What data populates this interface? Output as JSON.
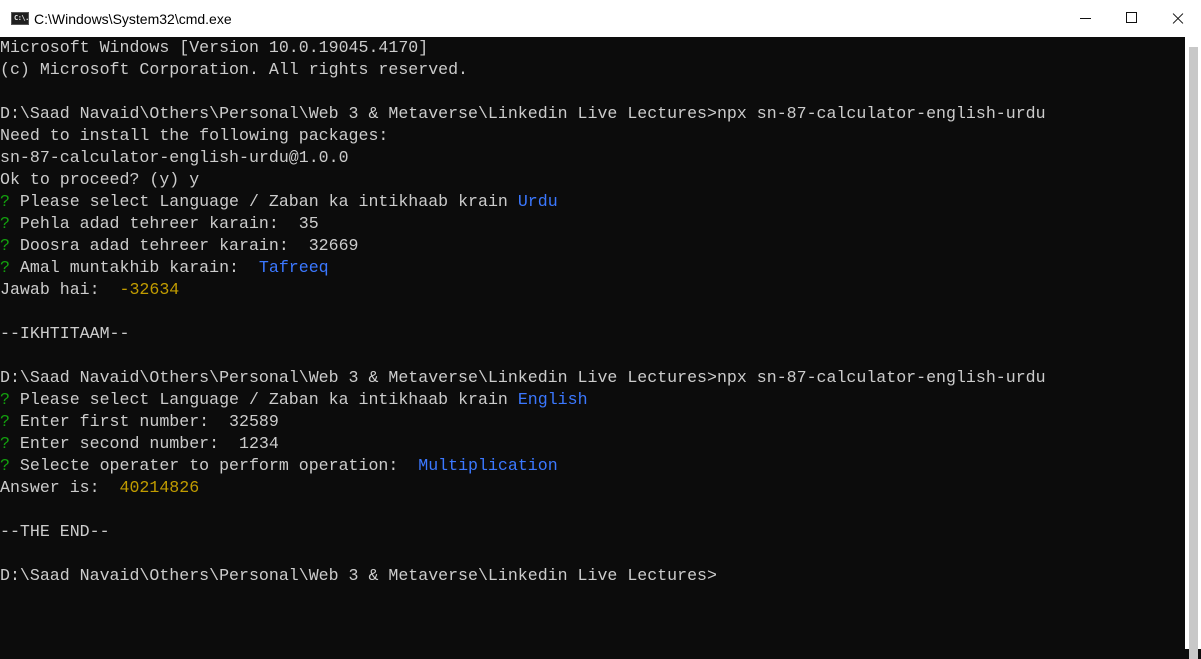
{
  "window": {
    "title": "C:\\Windows\\System32\\cmd.exe",
    "icon_text": "C:\\."
  },
  "console": {
    "header1": "Microsoft Windows [Version 10.0.19045.4170]",
    "header2": "(c) Microsoft Corporation. All rights reserved.",
    "cmd1": "D:\\Saad Navaid\\Others\\Personal\\Web 3 & Metaverse\\Linkedin Live Lectures>npx sn-87-calculator-english-urdu",
    "install_msg": "Need to install the following packages:",
    "package": "sn-87-calculator-english-urdu@1.0.0",
    "proceed": "Ok to proceed? (y) y",
    "q_mark": "?",
    "s1_lang_q": " Please select Language / Zaban ka intikhaab krain ",
    "s1_lang_a": "Urdu",
    "s1_first": " Pehla adad tehreer karain:  35",
    "s1_second": " Doosra adad tehreer karain:  32669",
    "s1_op_q": " Amal muntakhib karain:  ",
    "s1_op_a": "Tafreeq",
    "s1_result_label": "Jawab hai:  ",
    "s1_result": "-32634",
    "s1_end": "--IKHTITAAM--",
    "cmd2": "D:\\Saad Navaid\\Others\\Personal\\Web 3 & Metaverse\\Linkedin Live Lectures>npx sn-87-calculator-english-urdu",
    "s2_lang_q": " Please select Language / Zaban ka intikhaab krain ",
    "s2_lang_a": "English",
    "s2_first": " Enter first number:  32589",
    "s2_second": " Enter second number:  1234",
    "s2_op_q": " Selecte operater to perform operation:  ",
    "s2_op_a": "Multiplication",
    "s2_result_label": "Answer is:  ",
    "s2_result": "40214826",
    "s2_end": "--THE END--",
    "final_prompt": "D:\\Saad Navaid\\Others\\Personal\\Web 3 & Metaverse\\Linkedin Live Lectures>"
  },
  "colors": {
    "background": "#0c0c0c",
    "text": "#cccccc",
    "prompt_mark": "#13a10e",
    "answer_blue": "#3b78ff",
    "result_yellow": "#c19c00"
  }
}
